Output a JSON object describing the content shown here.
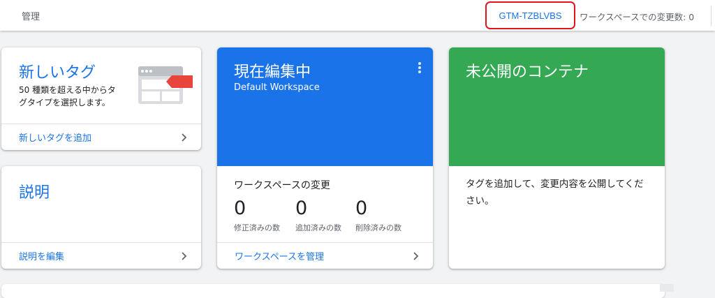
{
  "topbar": {
    "admin_label": "管理",
    "container_id": "GTM-TZBLVBS",
    "workspace_changes_label": "ワークスペースでの変更数: 0"
  },
  "new_tag_card": {
    "title": "新しいタグ",
    "description": "50 種類を超える中からタグタイプを選択します。",
    "footer_link": "新しいタグを追加"
  },
  "description_card": {
    "title": "説明",
    "footer_link": "説明を編集"
  },
  "workspace_card": {
    "title": "現在編集中",
    "subtitle": "Default Workspace",
    "changes_title": "ワークスペースの変更",
    "stats": [
      {
        "value": "0",
        "label": "修正済みの数"
      },
      {
        "value": "0",
        "label": "追加済みの数"
      },
      {
        "value": "0",
        "label": "削除済みの数"
      }
    ],
    "footer_link": "ワークスペースを管理"
  },
  "unpublished_card": {
    "title": "未公開のコンテナ",
    "body": "タグを追加して、変更内容を公開してください。"
  },
  "colors": {
    "accent_blue": "#1a73e8",
    "green": "#34a853",
    "highlight_red": "#e2131a",
    "tag_red": "#e8453c"
  },
  "icons": [
    "chevron-right-icon",
    "more-vert-icon",
    "tag-illustration-icon"
  ]
}
